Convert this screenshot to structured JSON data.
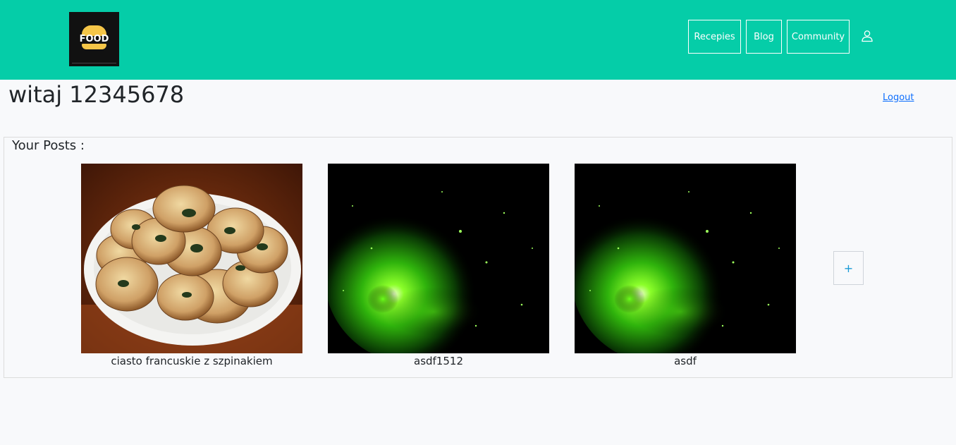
{
  "header": {
    "logo": {
      "text": "FOOD",
      "icon": "burger-logo-icon"
    },
    "nav": {
      "recipes_label": "Recepies",
      "blog_label": "Blog",
      "community_label": "Community"
    },
    "user_icon": "user-icon",
    "accent_color": "#05cda8"
  },
  "main": {
    "greeting": "witaj 12345678",
    "logout_label": "Logout"
  },
  "posts": {
    "title": "Your Posts :",
    "items": [
      {
        "caption": "ciasto francuskie z szpinakiem"
      },
      {
        "caption": "asdf1512"
      },
      {
        "caption": "asdf"
      }
    ],
    "add_label": "+"
  }
}
